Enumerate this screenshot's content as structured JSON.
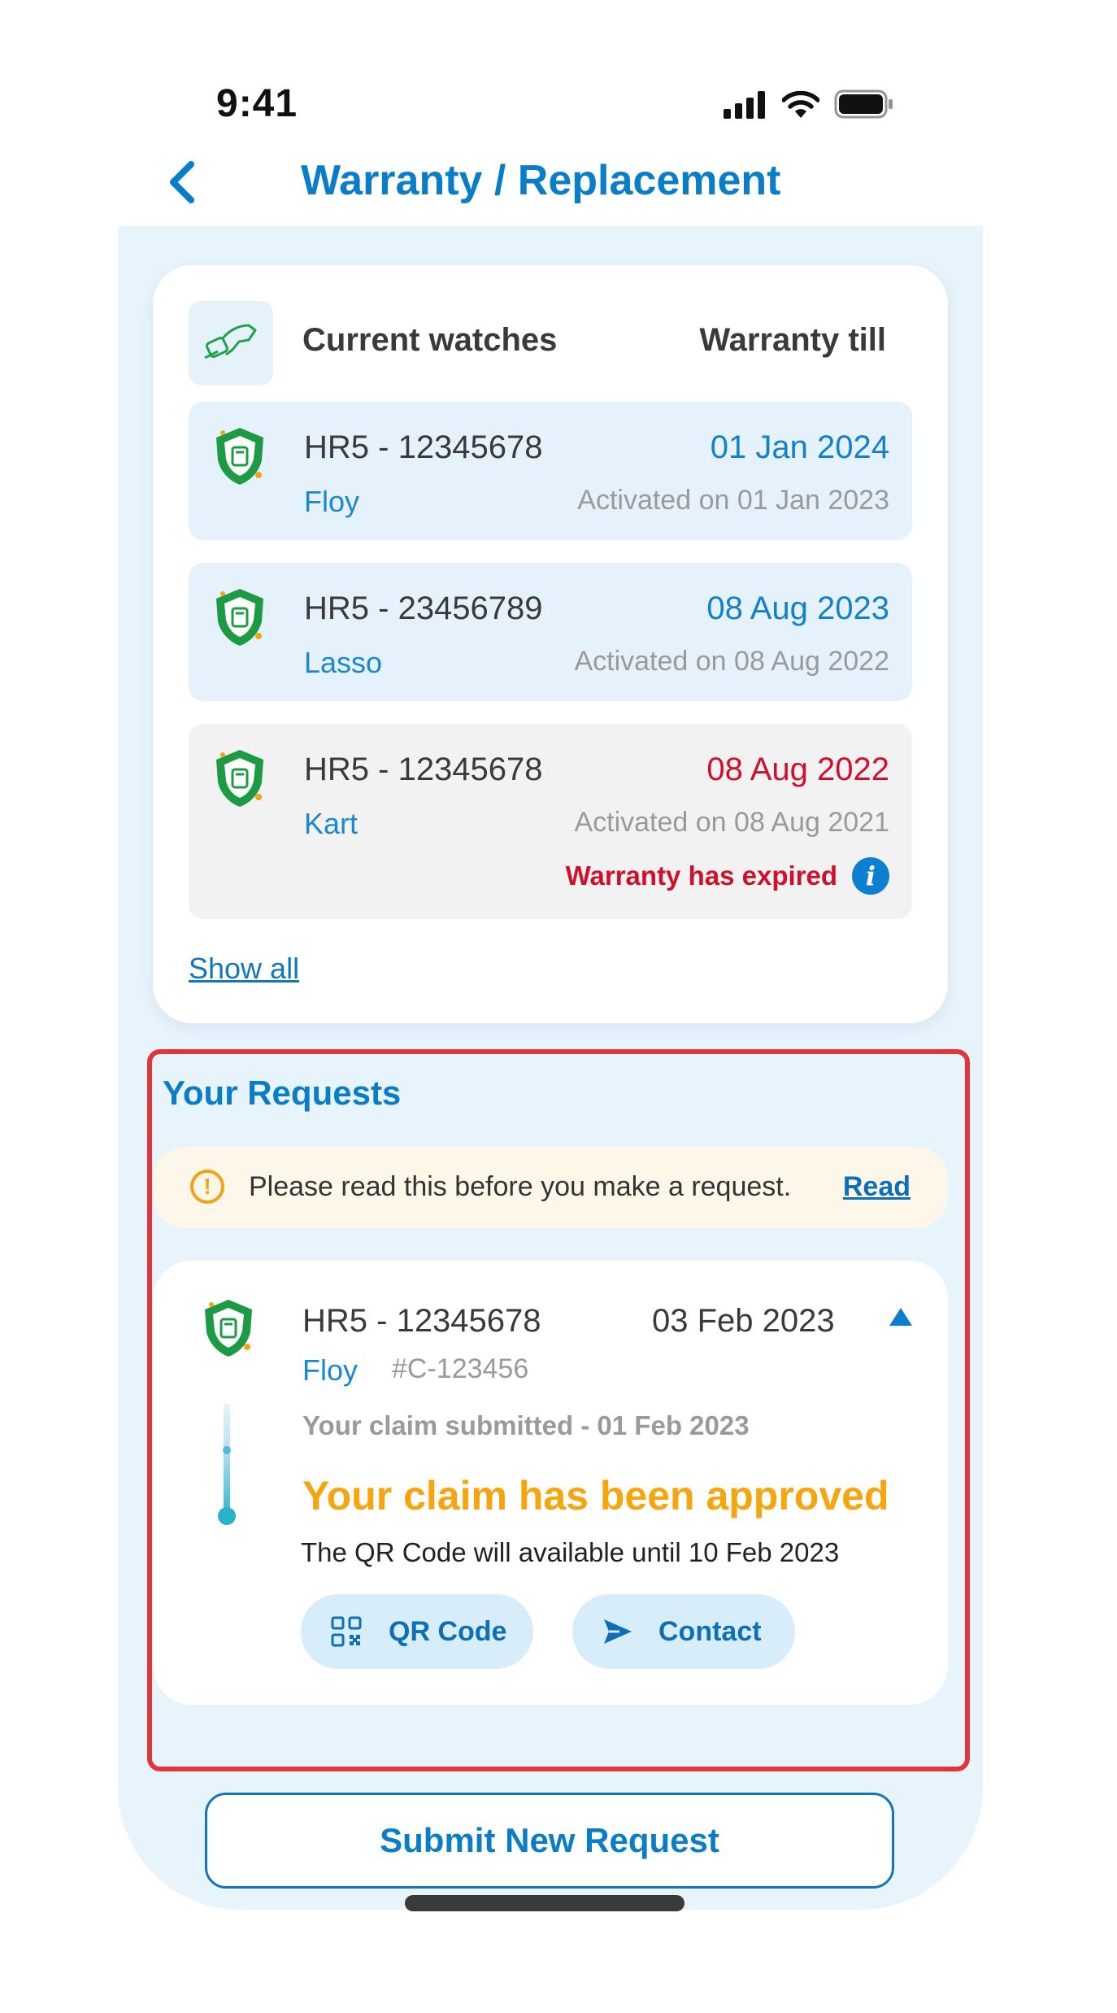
{
  "status_bar": {
    "time": "9:41"
  },
  "header": {
    "back_icon": "chevron-left-icon",
    "title": "Warranty / Replacement"
  },
  "watches": {
    "header_icon": "watch-hand-icon",
    "title": "Current watches",
    "warranty_till_label": "Warranty till",
    "items": [
      {
        "model": "HR5 - 12345678",
        "warranty_date": "01 Jan 2024",
        "name": "Floy",
        "activated": "Activated on 01 Jan 2023",
        "status": "active"
      },
      {
        "model": "HR5 - 23456789",
        "warranty_date": "08 Aug 2023",
        "name": "Lasso",
        "activated": "Activated on 08 Aug 2022",
        "status": "active"
      },
      {
        "model": "HR5 - 12345678",
        "warranty_date": "08 Aug 2022",
        "name": "Kart",
        "activated": "Activated on 08 Aug 2021",
        "status": "expired",
        "expired_text": "Warranty has expired"
      }
    ],
    "show_all": "Show all"
  },
  "requests": {
    "title": "Your Requests",
    "notice": {
      "text": "Please read this before you make a request.",
      "link": "Read"
    },
    "claim": {
      "model": "HR5 - 12345678",
      "date": "03 Feb 2023",
      "name": "Floy",
      "claim_id": "#C-123456",
      "submitted": "Your claim submitted - 01 Feb 2023",
      "status": "Your claim has been approved",
      "qr_note": "The QR Code will available until 10 Feb 2023",
      "qr_button": "QR Code",
      "contact_button": "Contact"
    }
  },
  "submit_button": "Submit New Request",
  "colors": {
    "primary": "#0a7dc9",
    "expired": "#d0102a",
    "approved": "#f6a50f",
    "screen_bg": "#e8f4fc",
    "highlight_border": "#e2353a"
  }
}
